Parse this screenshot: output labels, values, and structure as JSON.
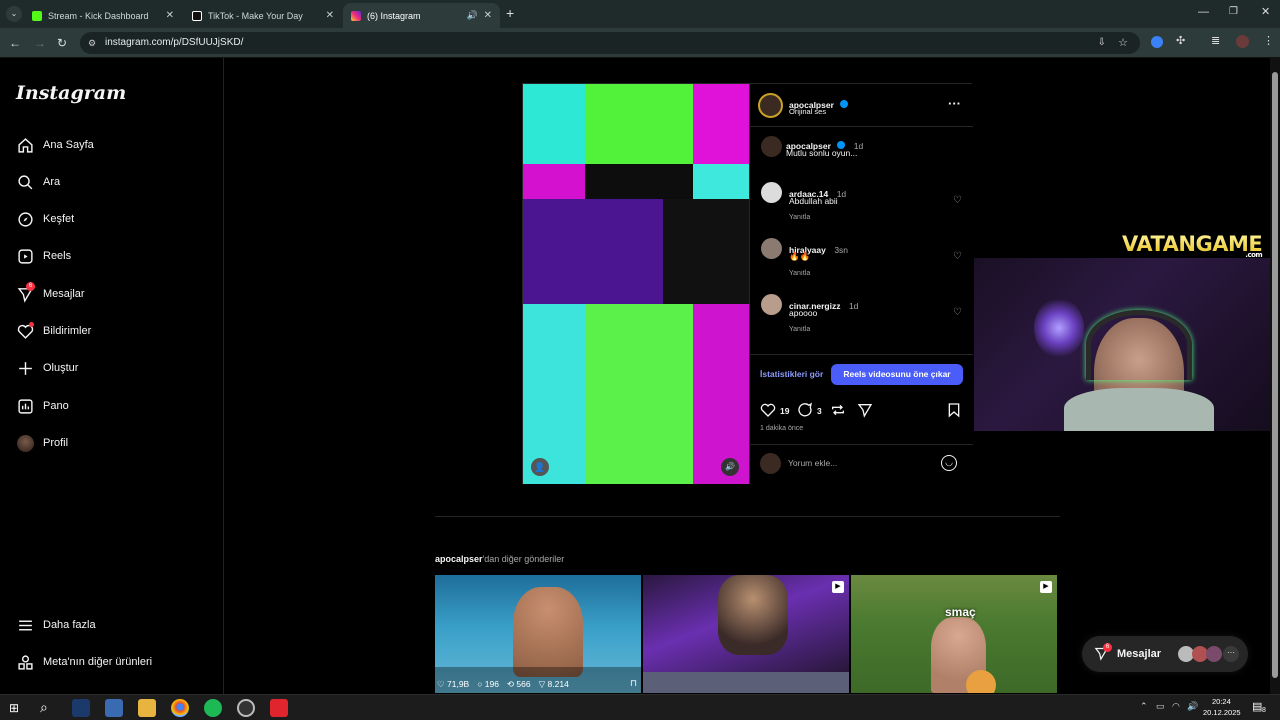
{
  "browser": {
    "tabs": [
      {
        "title": "Stream - Kick Dashboard",
        "color": "#53fc18"
      },
      {
        "title": "TikTok - Make Your Day",
        "color": "#ffffff"
      },
      {
        "title": "(6) Instagram",
        "color": "#e1306c"
      }
    ],
    "url": "instagram.com/p/DSfUUJjSKD/"
  },
  "sidebar": {
    "logo": "Instagram",
    "items": [
      {
        "label": "Ana Sayfa",
        "icon": "home-icon"
      },
      {
        "label": "Ara",
        "icon": "search-icon"
      },
      {
        "label": "Keşfet",
        "icon": "compass-icon"
      },
      {
        "label": "Reels",
        "icon": "reels-icon"
      },
      {
        "label": "Mesajlar",
        "icon": "messenger-icon",
        "badge": "6"
      },
      {
        "label": "Bildirimler",
        "icon": "heart-icon"
      },
      {
        "label": "Oluştur",
        "icon": "plus-icon"
      },
      {
        "label": "Pano",
        "icon": "dashboard-icon"
      },
      {
        "label": "Profil",
        "icon": "avatar"
      }
    ],
    "more": "Daha fazla",
    "meta": "Meta'nın diğer ürünleri"
  },
  "post": {
    "author": "apocalpser",
    "audio": "Orijinal ses",
    "caption_author": "apocalpser",
    "caption_time": "1d",
    "caption": "Mutlu sonlu oyun...",
    "comments": [
      {
        "user": "ardaac.14",
        "time": "1d",
        "text": "Abdullah abii",
        "reply": "Yanıtla"
      },
      {
        "user": "hiralyaay",
        "time": "3sn",
        "text": "🔥🔥",
        "reply": "Yanıtla"
      },
      {
        "user": "cinar.nergizz",
        "time": "1d",
        "text": "apoooo",
        "reply": "Yanıtla"
      }
    ],
    "insights": "İstatistikleri gör",
    "boost": "Reels videosunu öne çıkar",
    "likes": "19",
    "comment_count": "3",
    "posted": "1 dakika önce",
    "comment_placeholder": "Yorum ekle..."
  },
  "more_posts": {
    "user": "apocalpser",
    "suffix": "'dan diğer gönderiler",
    "stats": {
      "likes": "71,9B",
      "comments": "196",
      "reposts": "566",
      "shares": "8.214"
    },
    "overlay_text": "smaç"
  },
  "overlay": {
    "brand": "VATANGAME",
    "brand_sub": ".com"
  },
  "messages_pill": {
    "label": "Mesajlar",
    "badge": "6"
  },
  "taskbar": {
    "time": "20:24",
    "date": "20.12.2025",
    "notif": "8"
  }
}
